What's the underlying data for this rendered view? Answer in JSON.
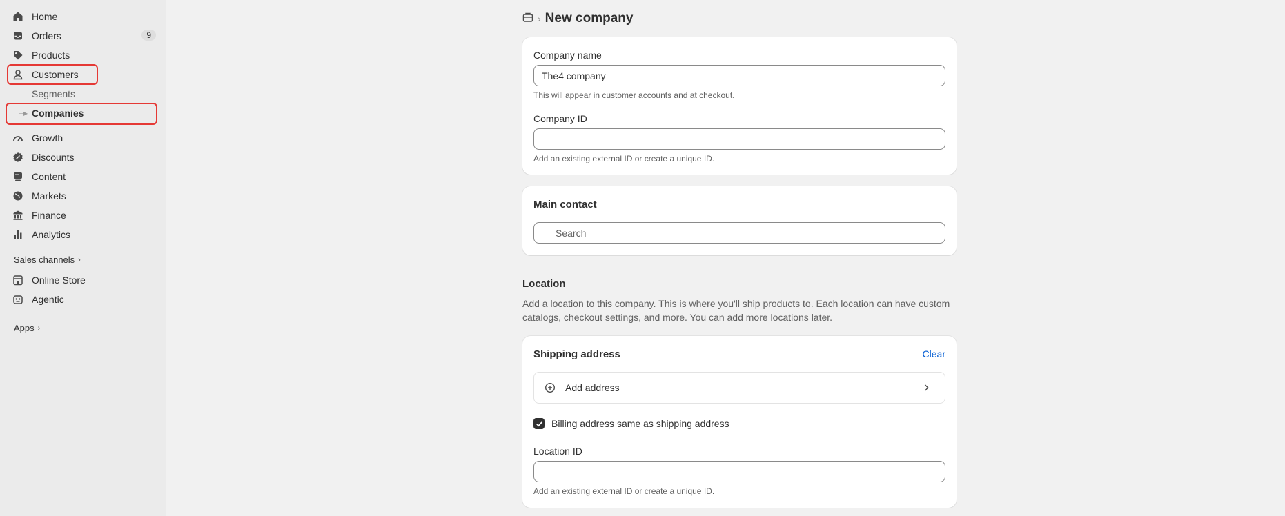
{
  "sidebar": {
    "items": [
      {
        "label": "Home",
        "icon": "home-icon"
      },
      {
        "label": "Orders",
        "icon": "inbox-icon",
        "badge": "9"
      },
      {
        "label": "Products",
        "icon": "tag-icon"
      },
      {
        "label": "Customers",
        "icon": "person-icon"
      }
    ],
    "sub_items": [
      {
        "label": "Segments"
      },
      {
        "label": "Companies"
      }
    ],
    "items2": [
      {
        "label": "Growth",
        "icon": "gauge-icon"
      },
      {
        "label": "Discounts",
        "icon": "discount-icon"
      },
      {
        "label": "Content",
        "icon": "content-icon"
      },
      {
        "label": "Markets",
        "icon": "globe-icon"
      },
      {
        "label": "Finance",
        "icon": "bank-icon"
      },
      {
        "label": "Analytics",
        "icon": "bar-chart-icon"
      }
    ],
    "sales_channels_label": "Sales channels",
    "channels": [
      {
        "label": "Online Store",
        "icon": "store-icon"
      },
      {
        "label": "Agentic",
        "icon": "robot-icon"
      }
    ],
    "apps_label": "Apps"
  },
  "page": {
    "breadcrumb_icon": "company-icon",
    "title": "New company"
  },
  "company_card": {
    "name_label": "Company name",
    "name_value": "The4 company",
    "name_help": "This will appear in customer accounts and at checkout.",
    "id_label": "Company ID",
    "id_value": "",
    "id_help": "Add an existing external ID or create a unique ID."
  },
  "contact_card": {
    "title": "Main contact",
    "search_placeholder": "Search"
  },
  "location": {
    "title": "Location",
    "description": "Add a location to this company. This is where you'll ship products to. Each location can have custom catalogs, checkout settings, and more. You can add more locations later."
  },
  "shipping_card": {
    "title": "Shipping address",
    "clear_label": "Clear",
    "add_address_label": "Add address",
    "billing_same_label": "Billing address same as shipping address",
    "billing_same_checked": true,
    "location_id_label": "Location ID",
    "location_id_value": "",
    "location_id_help": "Add an existing external ID or create a unique ID."
  },
  "colors": {
    "highlight": "#e53935",
    "link": "#005bd3",
    "sidebar_bg": "#ebebeb",
    "page_bg": "#f1f1f1"
  }
}
